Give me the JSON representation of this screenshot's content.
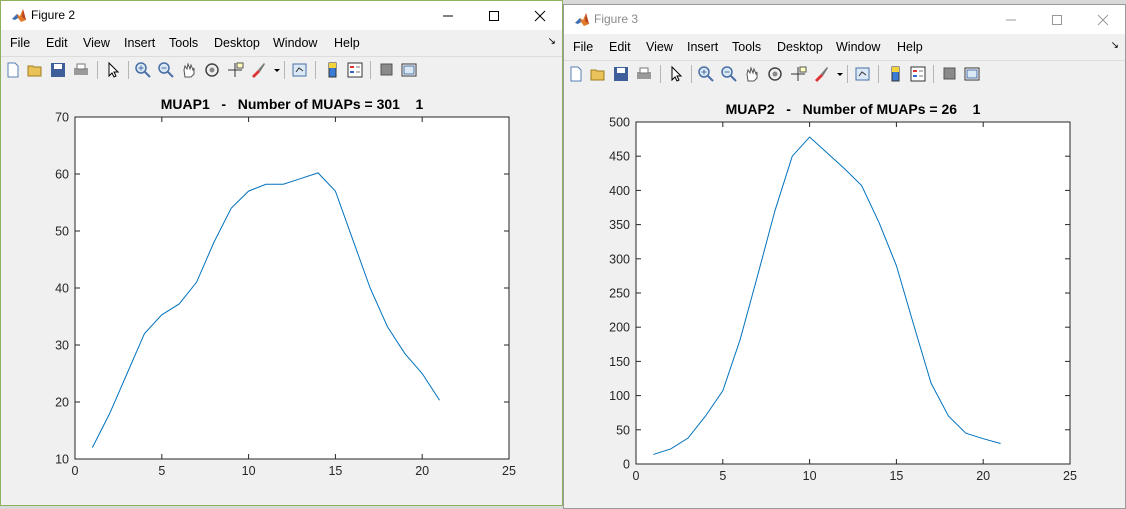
{
  "windows": [
    {
      "title": "Figure 2",
      "active": true,
      "menu": [
        "File",
        "Edit",
        "View",
        "Insert",
        "Tools",
        "Desktop",
        "Window",
        "Help"
      ],
      "chart_data": {
        "type": "line",
        "title": "MUAP1   -   Number of MUAPs = 301    1",
        "xlabel": "",
        "ylabel": "",
        "xlim": [
          0,
          25
        ],
        "ylim": [
          10,
          70
        ],
        "xticks": [
          0,
          5,
          10,
          15,
          20,
          25
        ],
        "yticks": [
          10,
          20,
          30,
          40,
          50,
          60,
          70
        ],
        "grid": false,
        "line_color": "#0072bd",
        "series": [
          {
            "x": [
              1,
              2,
              3,
              4,
              5,
              6,
              7,
              8,
              9,
              10,
              11,
              12,
              13,
              14,
              15,
              16,
              17,
              18,
              19,
              20,
              21
            ],
            "values": [
              12,
              18,
              25,
              32,
              35.3,
              37.2,
              41,
              48,
              54,
              57,
              58.2,
              58.2,
              59.2,
              60.2,
              57,
              48.5,
              40,
              33.2,
              28.5,
              25,
              20.3
            ]
          }
        ]
      }
    },
    {
      "title": "Figure 3",
      "active": false,
      "menu": [
        "File",
        "Edit",
        "View",
        "Insert",
        "Tools",
        "Desktop",
        "Window",
        "Help"
      ],
      "chart_data": {
        "type": "line",
        "title": "MUAP2   -   Number of MUAPs = 26    1",
        "xlabel": "",
        "ylabel": "",
        "xlim": [
          0,
          25
        ],
        "ylim": [
          0,
          500
        ],
        "xticks": [
          0,
          5,
          10,
          15,
          20,
          25
        ],
        "yticks": [
          0,
          50,
          100,
          150,
          200,
          250,
          300,
          350,
          400,
          450,
          500
        ],
        "grid": false,
        "line_color": "#0072bd",
        "series": [
          {
            "x": [
              1,
              2,
              3,
              4,
              5,
              6,
              7,
              8,
              9,
              10,
              11,
              12,
              13,
              14,
              15,
              16,
              17,
              18,
              19,
              20,
              21
            ],
            "values": [
              14,
              22,
              38,
              70,
              107,
              182,
              275,
              370,
              450,
              478,
              455,
              432,
              407,
              353,
              290,
              203,
              118,
              70,
              45,
              37,
              30
            ]
          }
        ]
      }
    }
  ]
}
